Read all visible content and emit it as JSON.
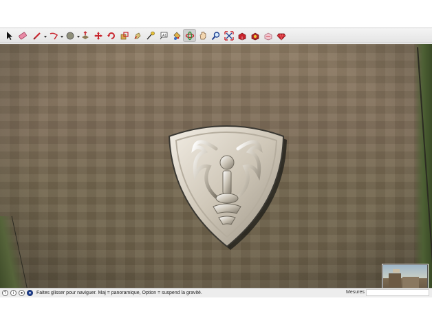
{
  "toolbar": {
    "tools": [
      {
        "icon": "select-arrow-icon"
      },
      {
        "icon": "eraser-icon"
      },
      {
        "icon": "pencil-line-icon"
      },
      {
        "icon": "arc-icon"
      },
      {
        "icon": "circle-shape-icon"
      },
      {
        "icon": "push-pull-icon"
      },
      {
        "icon": "move-icon"
      },
      {
        "icon": "rotate-icon"
      },
      {
        "icon": "scale-icon"
      },
      {
        "icon": "offset-icon"
      },
      {
        "icon": "tape-measure-icon"
      },
      {
        "icon": "text-tool-icon"
      },
      {
        "icon": "paint-bucket-icon"
      },
      {
        "icon": "orbit-icon"
      },
      {
        "icon": "pan-hand-icon"
      },
      {
        "icon": "zoom-icon"
      },
      {
        "icon": "zoom-extents-icon"
      },
      {
        "icon": "warehouse-icon"
      },
      {
        "icon": "extension-warehouse-icon"
      },
      {
        "icon": "components-icon"
      },
      {
        "icon": "ruby-icon"
      }
    ],
    "active_tool": "orbit-icon"
  },
  "statusbar": {
    "hint": "Faites glisser pour naviguer. Maj = panoramique, Option =  suspend la gravité.",
    "measures_label": "Mesures",
    "measures_value": ""
  },
  "colors": {
    "toolbar_bg": "#e9e9e9",
    "accent_red": "#c8232c",
    "status_icon_blue": "#1f3f8f"
  }
}
